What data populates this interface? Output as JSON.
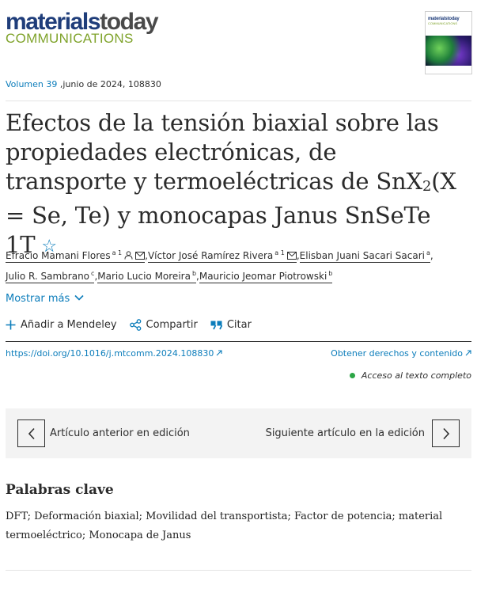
{
  "journal": {
    "logo_top_a": "materials",
    "logo_top_b": "today",
    "logo_bottom": "COMMUNICATIONS",
    "cover_title": "materialstoday",
    "cover_sub": "COMMUNICATIONS"
  },
  "volume": {
    "link": "Volumen 39",
    "rest": " ,junio de 2024, 108830"
  },
  "article": {
    "title_before": "Efectos de la tensión biaxial sobre las propiedades electrónicas, de transporte y termoeléctricas de SnX",
    "title_sub": "2",
    "title_after": "(X = Se, Te) y monocapas Janus SnSeTe 1T"
  },
  "authors": [
    {
      "name": "Efracio Mamani Flores",
      "sup": "a 1"
    },
    {
      "name": "Víctor José Ramírez Rivera",
      "sup": "a 1"
    },
    {
      "name": "Elisban Juani Sacari Sacari",
      "sup": "a"
    },
    {
      "name": "Julio R. Sambrano",
      "sup": "c"
    },
    {
      "name": "Mario Lucio Moreira",
      "sup": "b"
    },
    {
      "name": "Mauricio Jeomar Piotrowski",
      "sup": "b"
    }
  ],
  "show_more": "Mostrar más",
  "actions": {
    "mendeley": "Añadir a Mendeley",
    "share": "Compartir",
    "cite": "Citar"
  },
  "doi": "https://doi.org/10.1016/j.mtcomm.2024.108830",
  "rights": "Obtener derechos y contenido",
  "open_access": "Acceso al texto completo",
  "nav": {
    "prev": "Artículo anterior en edición",
    "next": "Siguiente artículo en la edición"
  },
  "keywords": {
    "heading": "Palabras clave",
    "text": "DFT; Deformación biaxial; Movilidad del transportista; Factor de potencia; material termoeléctrico; Monocapa de Janus"
  },
  "colors": {
    "link": "#0c7dbb",
    "brand_blue": "#1f3d7a",
    "brand_green": "#7fa32b",
    "open_access_dot": "#2ca646"
  }
}
